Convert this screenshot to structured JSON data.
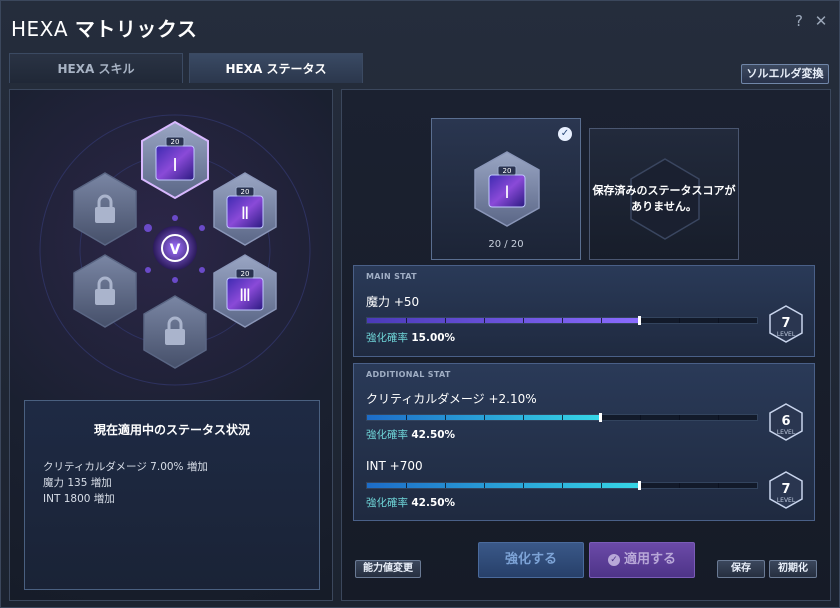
{
  "window": {
    "title_prefix": "HEXA",
    "title_main": "マトリックス",
    "help_icon": "?",
    "close_icon": "✕"
  },
  "tabs": [
    {
      "label": "HEXA スキル",
      "active": false
    },
    {
      "label": "HEXA ステータス",
      "active": true
    }
  ],
  "convert_button": "ソルエルダ変換",
  "hex_map": {
    "center_icon": "V",
    "nodes": [
      {
        "name": "top",
        "numeral": "Ⅰ",
        "level": "20",
        "locked": false
      },
      {
        "name": "upper-right",
        "numeral": "Ⅱ",
        "level": "20",
        "locked": false
      },
      {
        "name": "lower-right",
        "numeral": "Ⅲ",
        "level": "20",
        "locked": false
      },
      {
        "name": "bottom",
        "locked": true
      },
      {
        "name": "lower-left",
        "locked": true
      },
      {
        "name": "upper-left",
        "locked": true
      }
    ]
  },
  "status_box": {
    "title": "現在適用中のステータス状況",
    "lines": [
      "クリティカルダメージ 7.00% 増加",
      "魔力 135 増加",
      "INT 1800 増加"
    ]
  },
  "core_card": {
    "numeral": "Ⅰ",
    "level": "20",
    "progress": "20 / 20",
    "check_icon": "✓"
  },
  "score_card": {
    "message_line1": "保存済みのステータスコアが",
    "message_line2": "ありません。"
  },
  "main_stat": {
    "header": "MAIN STAT",
    "name": "魔力 +50",
    "rate_label": "強化確率",
    "rate_value": "15.00%",
    "level": "7",
    "level_label": "LEVEL",
    "fill": 0.7,
    "color": "#8a6cff"
  },
  "additional_stat": {
    "header": "ADDITIONAL STAT",
    "items": [
      {
        "name": "クリティカルダメージ +2.10%",
        "rate_label": "強化確率",
        "rate_value": "42.50%",
        "level": "6",
        "level_label": "LEVEL",
        "fill": 0.6
      },
      {
        "name": "INT +700",
        "rate_label": "強化確率",
        "rate_value": "42.50%",
        "level": "7",
        "level_label": "LEVEL",
        "fill": 0.7
      }
    ],
    "color": "#36d6e6"
  },
  "buttons": {
    "stat_change": "能力値変更",
    "enhance": "強化する",
    "apply": "適用する",
    "save": "保存",
    "reset": "初期化"
  }
}
